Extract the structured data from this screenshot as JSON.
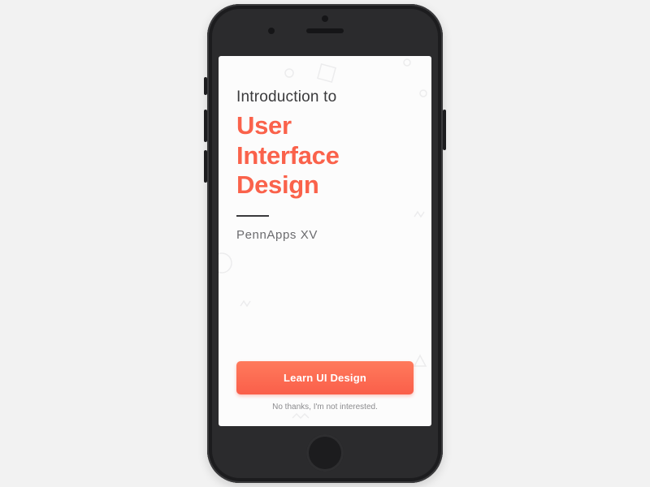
{
  "intro_line": "Introduction to",
  "headline_lines": [
    "User",
    "Interface",
    "Design"
  ],
  "subtitle": "PennApps XV",
  "cta_label": "Learn UI Design",
  "dismiss_label": "No thanks, I'm not interested.",
  "colors": {
    "accent": "#fa624b",
    "page_bg": "#f2f2f2",
    "screen_bg": "#fcfcfc"
  }
}
